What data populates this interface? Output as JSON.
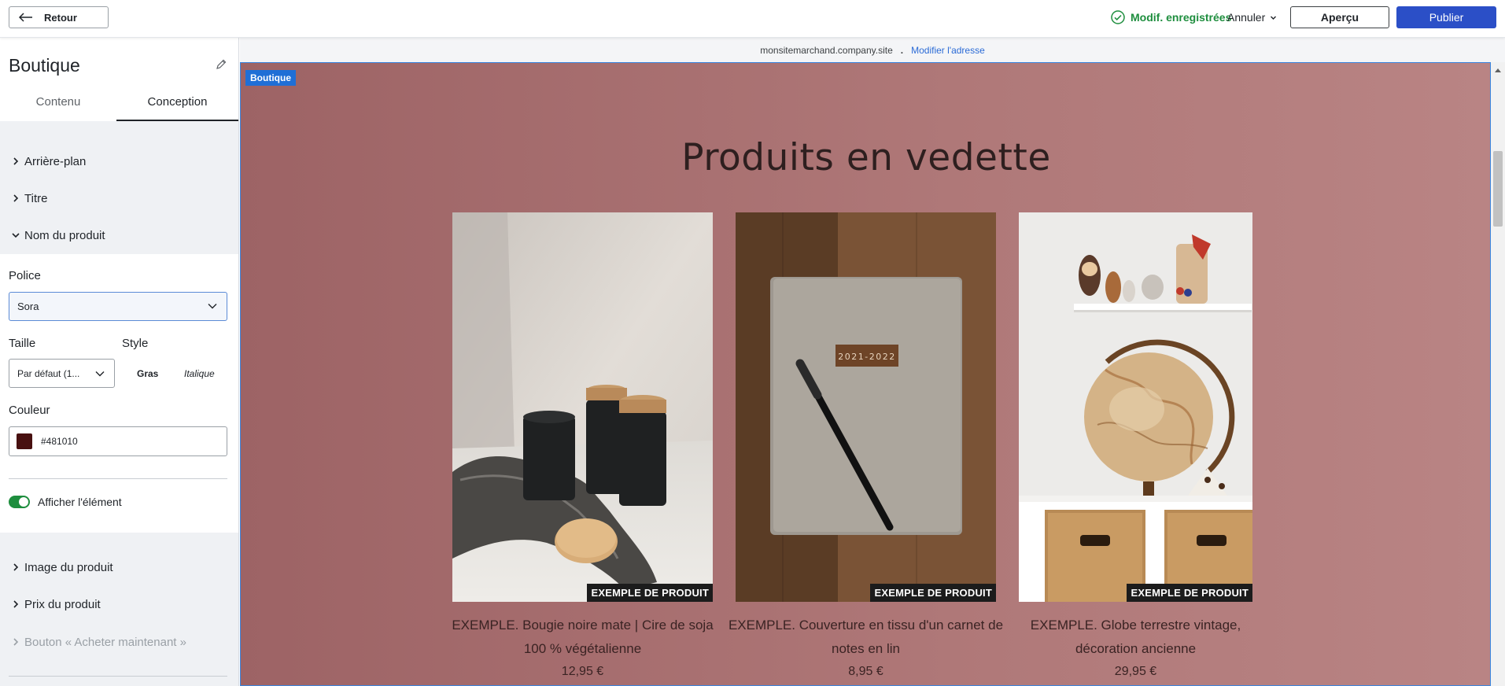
{
  "topbar": {
    "back_label": "Retour",
    "status_label": "Modif. enregistrées",
    "cancel_label": "Annuler",
    "preview_label": "Aperçu",
    "publish_label": "Publier"
  },
  "sidebar": {
    "title": "Boutique",
    "tabs": [
      {
        "label": "Contenu",
        "active": false
      },
      {
        "label": "Conception",
        "active": true
      }
    ],
    "accordion": {
      "arriere_plan": "Arrière-plan",
      "titre": "Titre",
      "nom_produit": "Nom du produit",
      "image_produit": "Image du produit",
      "prix_produit": "Prix du produit",
      "bouton_acheter": "Bouton « Acheter maintenant »"
    },
    "nom_produit_panel": {
      "font_label": "Police",
      "font_value": "Sora",
      "size_label": "Taille",
      "size_value": "Par défaut (1...",
      "style_label": "Style",
      "bold_label": "Gras",
      "italic_label": "Italique",
      "color_label": "Couleur",
      "color_value": "#481010",
      "color_swatch": "#481010",
      "show_label": "Afficher l'élément",
      "show_enabled": true
    }
  },
  "canvas": {
    "url": "monsitemarchand.company.site",
    "url_separator": ".",
    "edit_url_label": "Modifier l'adresse",
    "section_tag": "Boutique",
    "heading": "Produits en vedette",
    "products": [
      {
        "name": "EXEMPLE. Bougie noire mate | Cire de soja 100 % végétalienne",
        "price": "12,95 €",
        "badge": "EXEMPLE DE PRODUIT"
      },
      {
        "name": "EXEMPLE. Couverture en tissu d'un carnet de notes en lin",
        "price": "8,95 €",
        "badge": "EXEMPLE DE PRODUIT",
        "label_on_image": "2021-2022"
      },
      {
        "name": "EXEMPLE. Globe terrestre vintage, décoration ancienne",
        "price": "29,95 €",
        "badge": "EXEMPLE DE PRODUIT"
      }
    ]
  },
  "colors": {
    "accent": "#2b4fc7",
    "saved_green": "#1e8e3e",
    "page_bg": "#a56b6d",
    "selection_blue": "#1f6fd6"
  }
}
